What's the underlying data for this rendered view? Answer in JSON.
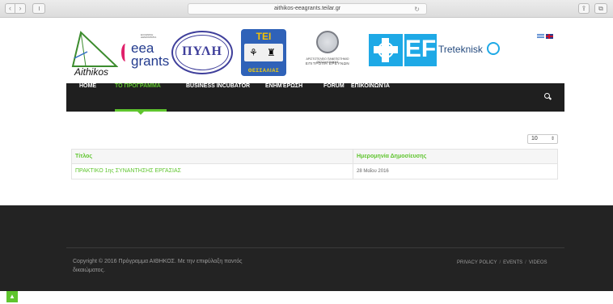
{
  "browser": {
    "url": "aithikos-eeagrants.teilar.gr",
    "back_label": "‹",
    "forward_label": "›",
    "reload_label": "↻",
    "share_label": "⇪",
    "tabs_label": "⧉"
  },
  "logos": {
    "aithikos": "Aithikos",
    "eea_small": "ΕΛΛΗΝΙΚΗ ΔΗΜΟΚΡΑΤΙΑ",
    "eea": "eea grants",
    "pylh": "ΠΥΛΗ",
    "tei_top": "ΤΕΙ",
    "tei_bottom": "ΘΕΣΣΑΛΙΑΣ",
    "seal_line1": "ΑΡΙΣΤΟΤΕΛΕΙΟ ΠΑΝΕΠΙΣΤΗΜΙΟ ΘΕΣΣΑΛΟΝΙΚΗΣ",
    "seal_line2": "ΕΠΙΤΡΟΠΗ ΕΡΕΥΝΩΝ",
    "ef": "EF",
    "treteknisk": "Treteknisk"
  },
  "nav": {
    "items": [
      "HOME",
      "ΤΟ ΠΡΟΓΡΑΜΜΑ",
      "BUSINESS INCUBATOR",
      "ΕΝΗΜΈΡΩΣΗ",
      "FORUM",
      "ΕΠΙΚΟΙΝΩΝΊΑ"
    ],
    "active_index": 1
  },
  "table": {
    "page_size": "10",
    "headers": [
      "Τίτλος",
      "Ημερομηνία Δημοσίευσης"
    ],
    "rows": [
      [
        "ΠΡΑΚΤΙΚΟ 1ης ΣΥΝΑΝΤΗΣΗΣ ΕΡΓΑΣΙΑΣ",
        "28 Μαΐου 2016"
      ]
    ]
  },
  "footer": {
    "copyright": "Copyright © 2016 Πρόγραμμα ΑΙΘΗΚΟΣ. Με την επιφύλαξη παντός δικαιώματος.",
    "links": [
      "PRIVACY POLICY",
      "EVENTS",
      "VIDEOS"
    ],
    "separator": "/"
  },
  "colors": {
    "accent": "#5fc52e",
    "nav_bg": "#1f1f1f",
    "footer_bg": "#232323"
  }
}
